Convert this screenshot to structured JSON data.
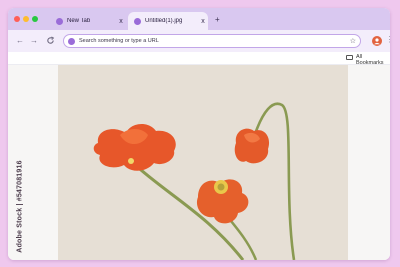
{
  "browser": {
    "tabs": [
      {
        "label": "New Tab",
        "active": false,
        "close": "x"
      },
      {
        "label": "Untitled(1).jpg",
        "active": true,
        "close": "x"
      }
    ],
    "new_tab_symbol": "+",
    "nav": {
      "back": "←",
      "forward": "→",
      "reload": "C"
    },
    "address_bar": {
      "placeholder": "Search something or type a URL",
      "bookmark_star": "☆"
    },
    "profile_initial": "",
    "menu": "⋮",
    "bookmarks": {
      "all_bookmarks_label": "All Bookmarks"
    }
  },
  "colors": {
    "page_bg": "#efc8ee",
    "tabstrip": "#d9c8f0",
    "toolbar": "#f3edfb",
    "accent": "#9a6cd8",
    "close_dot": "#ff5f57",
    "minimize_dot": "#febc2e",
    "maximize_dot": "#28c840",
    "profile": "#e26340"
  },
  "watermark": {
    "text": "Adobe Stock | #547081916"
  }
}
